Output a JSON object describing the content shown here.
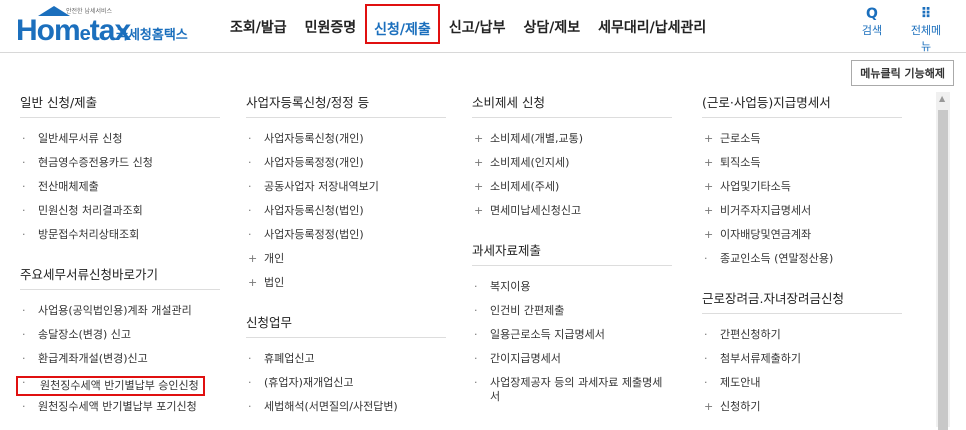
{
  "logo": {
    "brand_main": "Hom",
    "brand_e": "e",
    "brand_rest": "tax",
    "sub": "안전한 납세서비스",
    "kr": "국세청홈택스"
  },
  "gnb": [
    "조회/발급",
    "민원증명",
    "신청/제출",
    "신고/납부",
    "상담/제보",
    "세무대리/납세관리"
  ],
  "tools": {
    "search_icon": "Q",
    "search": "검색",
    "menu_icon": "⠿",
    "menu": "전체메뉴"
  },
  "toolbar": {
    "release_label": "메뉴클릭 기능해제"
  },
  "col1": {
    "title": "일반 신청/제출",
    "items": [
      "일반세무서류 신청",
      "현금영수증전용카드 신청",
      "전산매체제출",
      "민원신청 처리결과조회",
      "방문접수처리상태조회"
    ],
    "title2": "주요세무서류신청바로가기",
    "items2": [
      "사업용(공익법인용)계좌 개설관리",
      "송달장소(변경) 신고",
      "환급계좌개설(변경)신고",
      "원천징수세액 반기별납부 승인신청",
      "원천징수세액 반기별납부 포기신청"
    ]
  },
  "col2": {
    "title": "사업자등록신청/정정 등",
    "items": [
      "사업자등록신청(개인)",
      "사업자등록정정(개인)",
      "공동사업자 저장내역보기",
      "사업자등록신청(법인)",
      "사업자등록정정(법인)",
      "개인",
      "법인"
    ],
    "title2": "신청업무",
    "items2": [
      "휴폐업신고",
      "(휴업자)재개업신고",
      "세법해석(서면질의/사전답변)"
    ]
  },
  "col3": {
    "title": "소비제세 신청",
    "items": [
      "소비제세(개별,교통)",
      "소비제세(인지세)",
      "소비제세(주세)",
      "면세미납세신청신고"
    ],
    "title2": "과세자료제출",
    "items2": [
      "복지이용",
      "인건비 간편제출",
      "일용근로소득 지급명세서",
      "간이지급명세서",
      "사업장제공자 등의 과세자료 제출명세서"
    ]
  },
  "col4": {
    "title": "(근로·사업등)지급명세서",
    "items": [
      "근로소득",
      "퇴직소득",
      "사업및기타소득",
      "비거주자지급명세서",
      "이자배당및연금계좌",
      "종교인소득 (연말정산용)"
    ],
    "title2": "근로장려금.자녀장려금신청",
    "items2": [
      "간편신청하기",
      "첨부서류제출하기",
      "제도안내",
      "신청하기"
    ]
  },
  "colors": {
    "brand": "#1b6fbd",
    "highlight": "#e01010"
  }
}
